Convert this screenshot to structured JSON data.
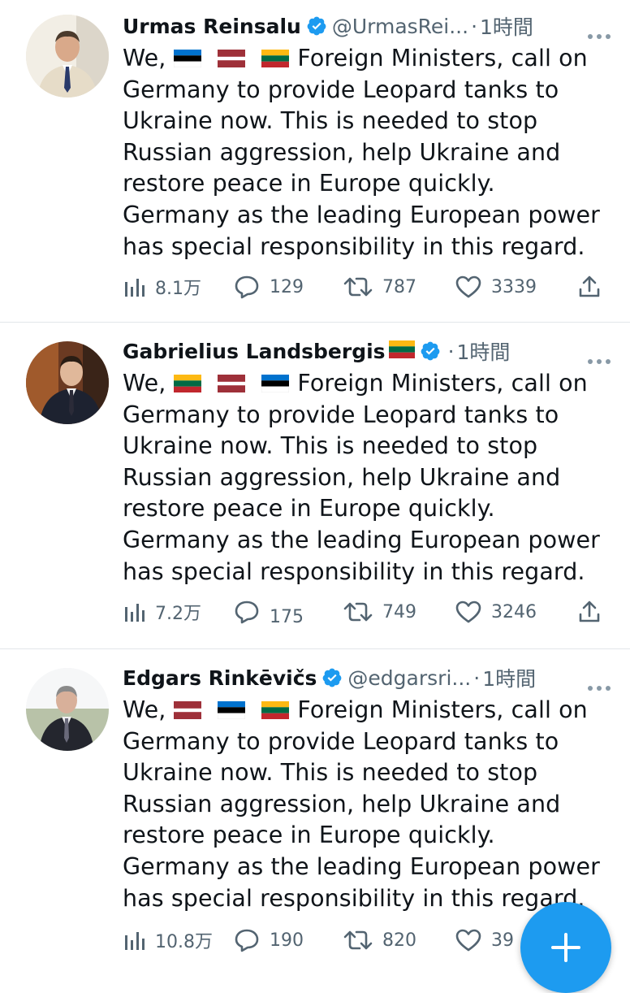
{
  "tweets": [
    {
      "display_name": "Urmas Reinsalu",
      "name_flag": "",
      "handle": "@UrmasRei...",
      "separator": "·",
      "time": "1時間",
      "avatar_icon": "person-photo-avatar",
      "flags": [
        "estonia",
        "latvia",
        "lithuania"
      ],
      "lines": [
        "Foreign Ministers, call on",
        "Germany to provide Leopard tanks to",
        "Ukraine now. This is needed to stop",
        "Russian aggression, help Ukraine and",
        "restore peace in Europe quickly.",
        "Germany as the leading European power",
        "has special responsibility in this regard."
      ],
      "first_word": "We,",
      "views": "8.1万",
      "replies": "129",
      "retweets": "787",
      "likes": "3339"
    },
    {
      "display_name": "Gabrielius Landsbergis",
      "name_flag": "lithuania",
      "handle": "",
      "separator": "·",
      "time": "1時間",
      "avatar_icon": "person-photo-avatar",
      "flags": [
        "lithuania",
        "latvia",
        "estonia"
      ],
      "lines": [
        "Foreign Ministers, call on",
        "Germany to provide Leopard tanks to",
        "Ukraine now. This is needed to stop",
        "Russian aggression, help Ukraine and",
        "restore peace in Europe quickly.",
        "Germany as the leading European power",
        "has special responsibility in this regard."
      ],
      "first_word": "We,",
      "views": "7.2万",
      "replies": "175",
      "retweets": "749",
      "likes": "3246"
    },
    {
      "display_name": "Edgars Rinkēvičs",
      "name_flag": "",
      "handle": "@edgarsri...",
      "separator": "·",
      "time": "1時間",
      "avatar_icon": "person-photo-avatar",
      "flags": [
        "latvia",
        "estonia",
        "lithuania"
      ],
      "lines": [
        "Foreign Ministers, call on",
        "Germany to provide Leopard tanks to",
        "Ukraine now. This is needed to stop",
        "Russian aggression, help Ukraine and",
        "restore peace in Europe quickly.",
        "Germany as the leading European power",
        "has special responsibility in this regard."
      ],
      "first_word": "We,",
      "views": "10.8万",
      "replies": "190",
      "retweets": "820",
      "likes": "39"
    }
  ],
  "colors": {
    "text": "#0f1419",
    "secondary": "#536471",
    "accent": "#1d9bf0",
    "divider": "#e2e6ea"
  },
  "icons": {
    "verified": "verified-badge-icon",
    "more": "more-options-icon",
    "views": "views-chart-icon",
    "reply": "reply-bubble-icon",
    "retweet": "retweet-icon",
    "like": "heart-icon",
    "share": "share-icon",
    "compose": "compose-plus-icon"
  }
}
